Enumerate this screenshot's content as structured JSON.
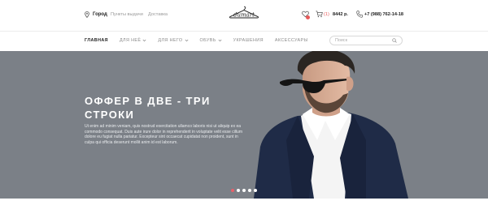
{
  "topbar": {
    "city": "Город",
    "links": [
      "Пункты выдачи",
      "Доставка"
    ],
    "cart_count": "(1)",
    "cart_total": "8442 р.",
    "phone": "+7 (988) 762-14-18"
  },
  "logo": {
    "text": "dumart"
  },
  "nav": {
    "items": [
      {
        "label": "ГЛАВНАЯ",
        "active": true,
        "dropdown": false
      },
      {
        "label": "ДЛЯ НЕЁ",
        "active": false,
        "dropdown": true
      },
      {
        "label": "ДЛЯ НЕГО",
        "active": false,
        "dropdown": true
      },
      {
        "label": "ОБУВЬ",
        "active": false,
        "dropdown": true
      },
      {
        "label": "УКРАШЕНИЯ",
        "active": false,
        "dropdown": false
      },
      {
        "label": "АКСЕССУАРЫ",
        "active": false,
        "dropdown": false
      }
    ]
  },
  "search": {
    "placeholder": "Поиск",
    "value": ""
  },
  "hero": {
    "title": "ОФФЕР В ДВЕ - ТРИ СТРОКИ",
    "text": "Ut enim ad minim veniam, quis nostrud exercitation ullamco laboris nisi ut aliquip ex ea commodo consequat. Duis aute irure dolor in reprehenderit in voluptate velit esse cillum dolore eu fugiat nulla pariatur. Excepteur sint occaecat cupidatat non proident, sunt in culpa qui officia deserunt mollit anim id est laborum.",
    "slides_total": 5,
    "active_slide": 1
  },
  "colors": {
    "accent": "#e85a5a",
    "hero_bg": "#7b8087",
    "jacket": "#1f2b47"
  }
}
